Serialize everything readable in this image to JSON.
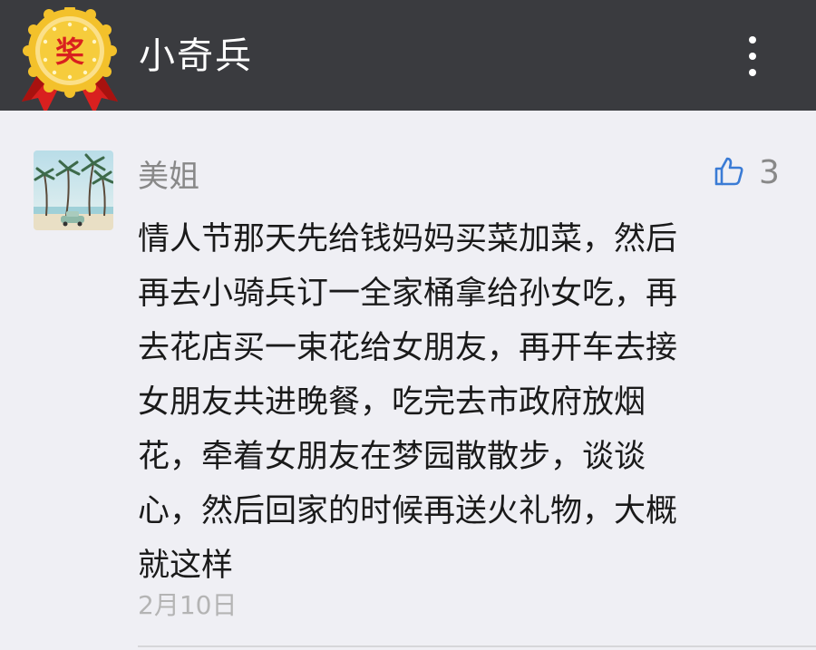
{
  "header": {
    "title": "小奇兵",
    "badge_char": "奖",
    "badge_icon": "award-ribbon-icon",
    "more_icon": "more-vertical-icon"
  },
  "comment": {
    "author": "美姐",
    "avatar": "avatar-beach-palm-trees",
    "likes": "3",
    "like_icon": "thumbs-up-icon",
    "text": "情人节那天先给钱妈妈买菜加菜，然后\n再去小骑兵订一全家桶拿给孙女吃，再\n去花店买一束花给女朋友，再开车去接\n女朋友共进晚餐，吃完去市政府放烟\n花，牵着女朋友在梦园散散步，谈谈\n心，然后回家的时候再送火礼物，大概\n就这样",
    "date": "2月10日"
  },
  "colors": {
    "header_bg": "#3a3b3f",
    "page_bg": "#efeff4",
    "like_blue": "#3a7bd5",
    "badge_gold": "#f3c12b",
    "badge_red": "#d9201f"
  }
}
